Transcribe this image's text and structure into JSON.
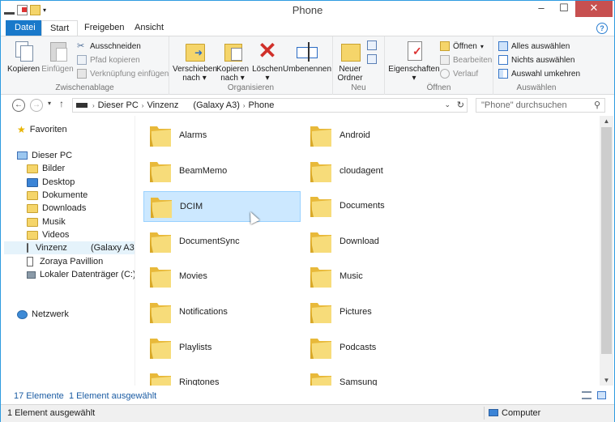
{
  "window": {
    "title": "Phone"
  },
  "tabs": [
    "Datei",
    "Start",
    "Freigeben",
    "Ansicht"
  ],
  "ribbon": {
    "clipboard": {
      "label": "Zwischenablage",
      "copy": "Kopieren",
      "paste": "Einfügen",
      "cut": "Ausschneiden",
      "copy_path": "Pfad kopieren",
      "paste_shortcut": "Verknüpfung einfügen"
    },
    "organize": {
      "label": "Organisieren",
      "move_to": [
        "Verschieben",
        "nach"
      ],
      "copy_to": [
        "Kopieren",
        "nach"
      ],
      "delete": "Löschen",
      "rename": "Umbenennen"
    },
    "new": {
      "label": "Neu",
      "new_folder": [
        "Neuer",
        "Ordner"
      ]
    },
    "open": {
      "label": "Öffnen",
      "properties": "Eigenschaften",
      "open": "Öffnen",
      "edit": "Bearbeiten",
      "history": "Verlauf"
    },
    "select": {
      "label": "Auswählen",
      "select_all": "Alles auswählen",
      "select_none": "Nichts auswählen",
      "invert": "Auswahl umkehren"
    }
  },
  "address": {
    "segments": [
      "Dieser PC",
      "Vinzenz",
      "(Galaxy A3)",
      "Phone"
    ],
    "search_placeholder": "\"Phone\" durchsuchen"
  },
  "nav": {
    "favorites": "Favoriten",
    "this_pc": "Dieser PC",
    "items": [
      "Bilder",
      "Desktop",
      "Dokumente",
      "Downloads",
      "Musik",
      "Videos"
    ],
    "device_name": "Vinzenz",
    "device_model": "(Galaxy A3)",
    "user": "Zoraya Pavillion",
    "drive": "Lokaler Datenträger (C:)",
    "network": "Netzwerk"
  },
  "folders": [
    "Alarms",
    "Android",
    "BeamMemo",
    "cloudagent",
    "DCIM",
    "Documents",
    "DocumentSync",
    "Download",
    "Movies",
    "Music",
    "Notifications",
    "Pictures",
    "Playlists",
    "Podcasts",
    "Ringtones",
    "Samsung"
  ],
  "selected_folder": "DCIM",
  "status": {
    "count": "17 Elemente",
    "selected": "1 Element ausgewählt",
    "bottom_left": "1 Element ausgewählt",
    "bottom_right": "Computer"
  },
  "colors": {
    "accent": "#1979ca",
    "selection": "#cce8ff",
    "folder": "#f5d56a"
  }
}
